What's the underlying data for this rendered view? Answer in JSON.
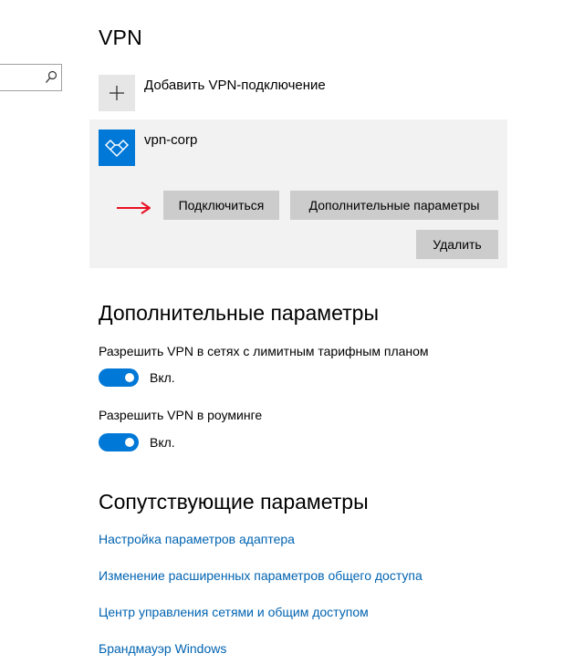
{
  "page": {
    "title": "VPN"
  },
  "add_vpn": {
    "label": "Добавить VPN-подключение",
    "icon": "plus-icon"
  },
  "vpn_connection": {
    "name": "vpn-corp",
    "icon": "vpn-icon",
    "connect_label": "Подключиться",
    "advanced_label": "Дополнительные параметры",
    "delete_label": "Удалить"
  },
  "advanced_section": {
    "title": "Дополнительные параметры",
    "settings": [
      {
        "label": "Разрешить VPN в сетях с лимитным тарифным планом",
        "state": "Вкл.",
        "on": true
      },
      {
        "label": "Разрешить VPN в роуминге",
        "state": "Вкл.",
        "on": true
      }
    ]
  },
  "related_section": {
    "title": "Сопутствующие параметры",
    "links": [
      "Настройка параметров адаптера",
      "Изменение расширенных параметров общего доступа",
      "Центр управления сетями и общим доступом",
      "Брандмауэр Windows"
    ]
  },
  "colors": {
    "accent": "#0078d7",
    "link": "#0063b1",
    "button": "#cccccc",
    "card": "#f2f2f2",
    "annotation_arrow": "#e81123"
  }
}
